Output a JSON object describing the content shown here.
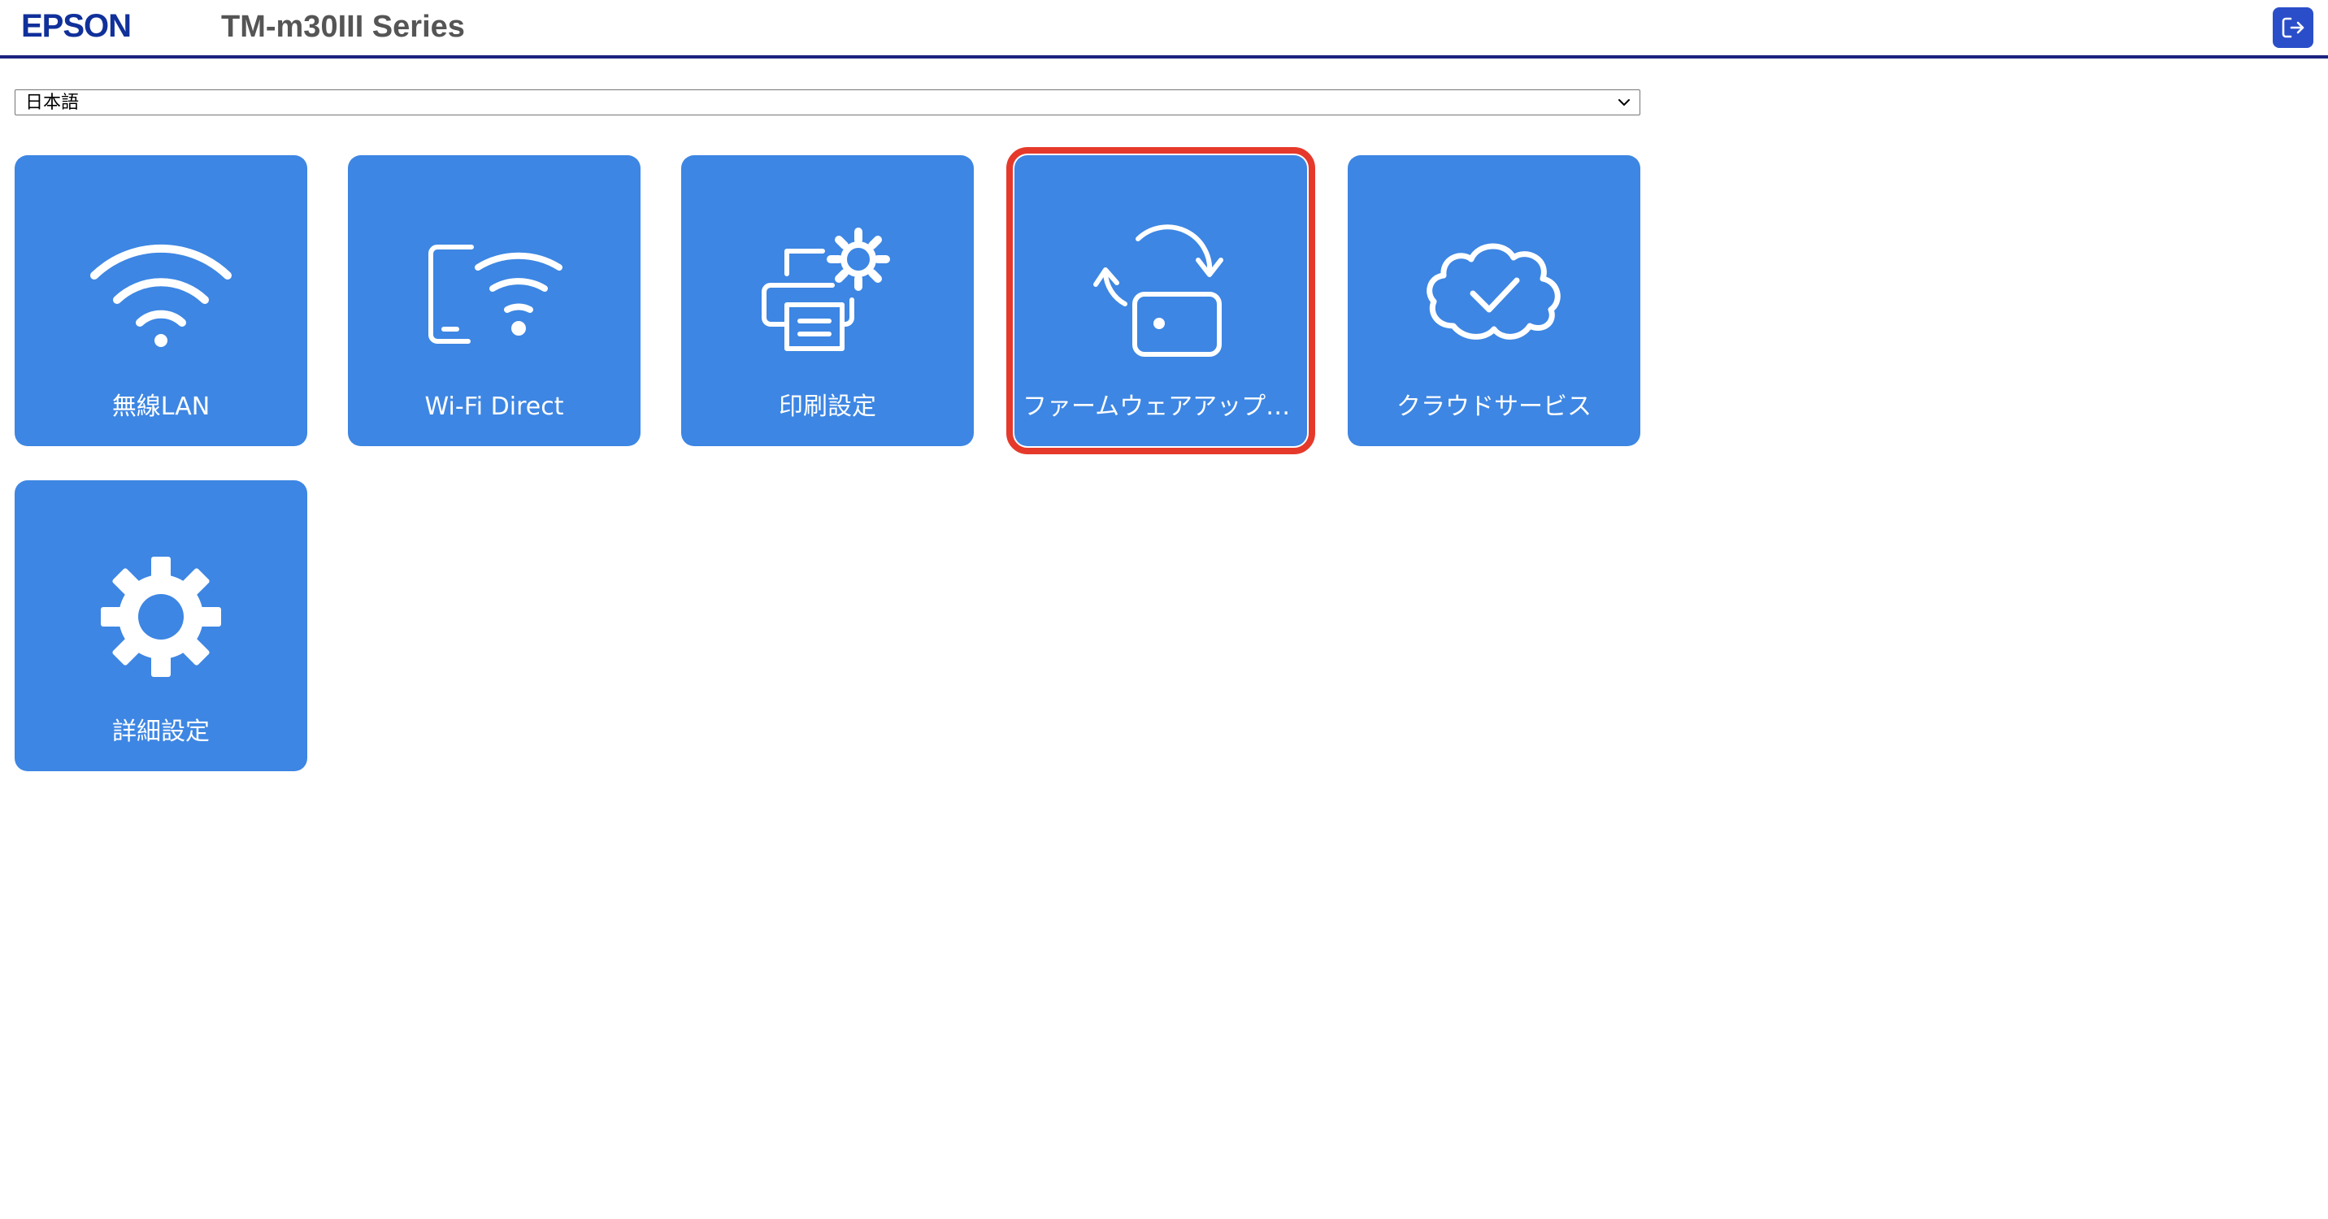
{
  "header": {
    "logo": "EPSON",
    "product_title": "TM-m30III Series",
    "logout_icon": "logout-icon"
  },
  "language_select": {
    "selected": "日本語"
  },
  "tiles": [
    {
      "label": "無線LAN",
      "icon": "wifi-icon"
    },
    {
      "label": "Wi-Fi Direct",
      "icon": "wifi-direct-icon"
    },
    {
      "label": "印刷設定",
      "icon": "printer-settings-icon"
    },
    {
      "label": "ファームウェアアップデート",
      "icon": "firmware-update-icon",
      "highlighted": true
    },
    {
      "label": "クラウドサービス",
      "icon": "cloud-check-icon"
    },
    {
      "label": "詳細設定",
      "icon": "gear-icon"
    }
  ],
  "colors": {
    "tile_bg": "#3d86e3",
    "header_rule": "#1a237e",
    "logo": "#10309a",
    "highlight": "#e53a2b",
    "logout_bg": "#2a4ec9"
  }
}
